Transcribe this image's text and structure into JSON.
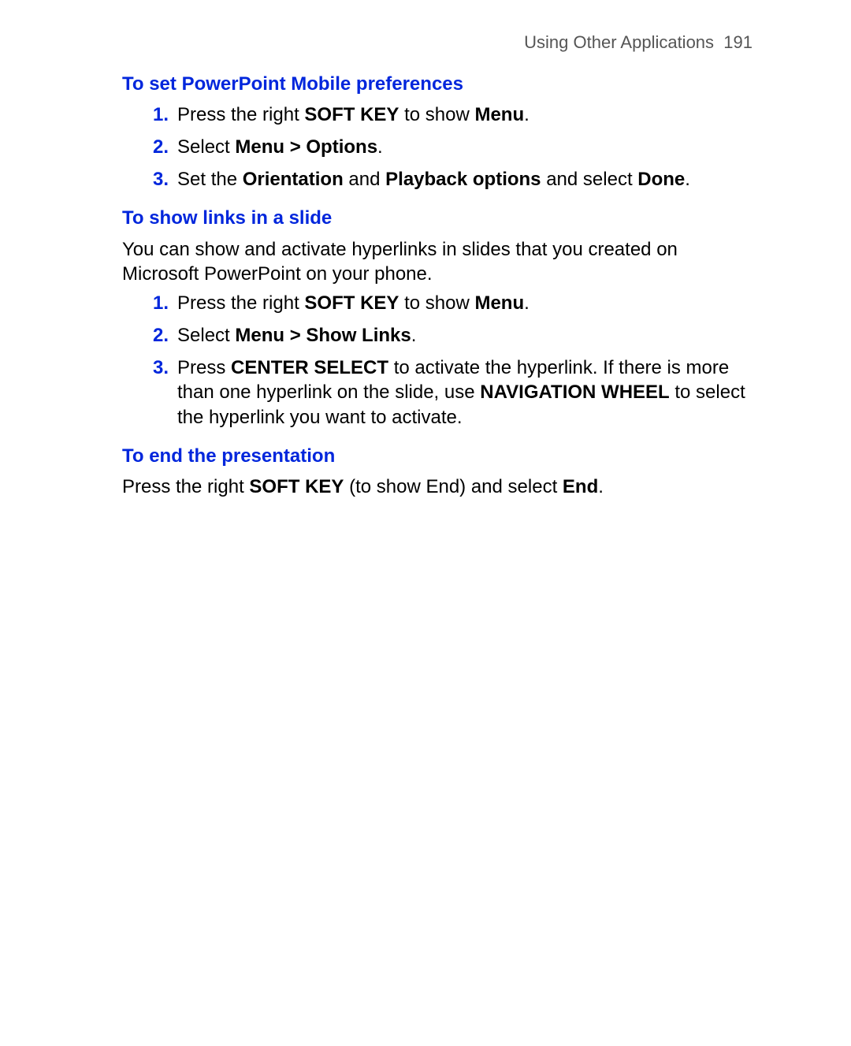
{
  "header": {
    "title": "Using Other Applications",
    "page": "191"
  },
  "sections": [
    {
      "heading": "To set PowerPoint Mobile preferences",
      "body": "",
      "items": [
        [
          {
            "t": "Press the right "
          },
          {
            "t": "SOFT KEY",
            "b": true
          },
          {
            "t": " to show "
          },
          {
            "t": "Menu",
            "b": true
          },
          {
            "t": "."
          }
        ],
        [
          {
            "t": "Select "
          },
          {
            "t": "Menu > Options",
            "b": true
          },
          {
            "t": "."
          }
        ],
        [
          {
            "t": "Set the "
          },
          {
            "t": "Orientation",
            "b": true
          },
          {
            "t": " and "
          },
          {
            "t": "Playback options",
            "b": true
          },
          {
            "t": " and select "
          },
          {
            "t": "Done",
            "b": true
          },
          {
            "t": "."
          }
        ]
      ]
    },
    {
      "heading": "To show links in a slide",
      "body": "You can show and activate hyperlinks in slides that you created on Microsoft PowerPoint on your phone.",
      "items": [
        [
          {
            "t": "Press the right "
          },
          {
            "t": "SOFT KEY",
            "b": true
          },
          {
            "t": " to show "
          },
          {
            "t": "Menu",
            "b": true
          },
          {
            "t": "."
          }
        ],
        [
          {
            "t": "Select "
          },
          {
            "t": "Menu > Show Links",
            "b": true
          },
          {
            "t": "."
          }
        ],
        [
          {
            "t": "Press "
          },
          {
            "t": "CENTER SELECT",
            "b": true
          },
          {
            "t": " to activate the hyperlink. If there is more than one hyperlink on the slide, use "
          },
          {
            "t": "NAVIGATION WHEEL",
            "b": true
          },
          {
            "t": " to select the hyperlink you want to activate."
          }
        ]
      ]
    },
    {
      "heading": "To end the presentation",
      "body_rich": [
        {
          "t": "Press the right "
        },
        {
          "t": "SOFT KEY",
          "b": true
        },
        {
          "t": " (to show End) and select "
        },
        {
          "t": "End",
          "b": true
        },
        {
          "t": "."
        }
      ],
      "items": []
    }
  ]
}
